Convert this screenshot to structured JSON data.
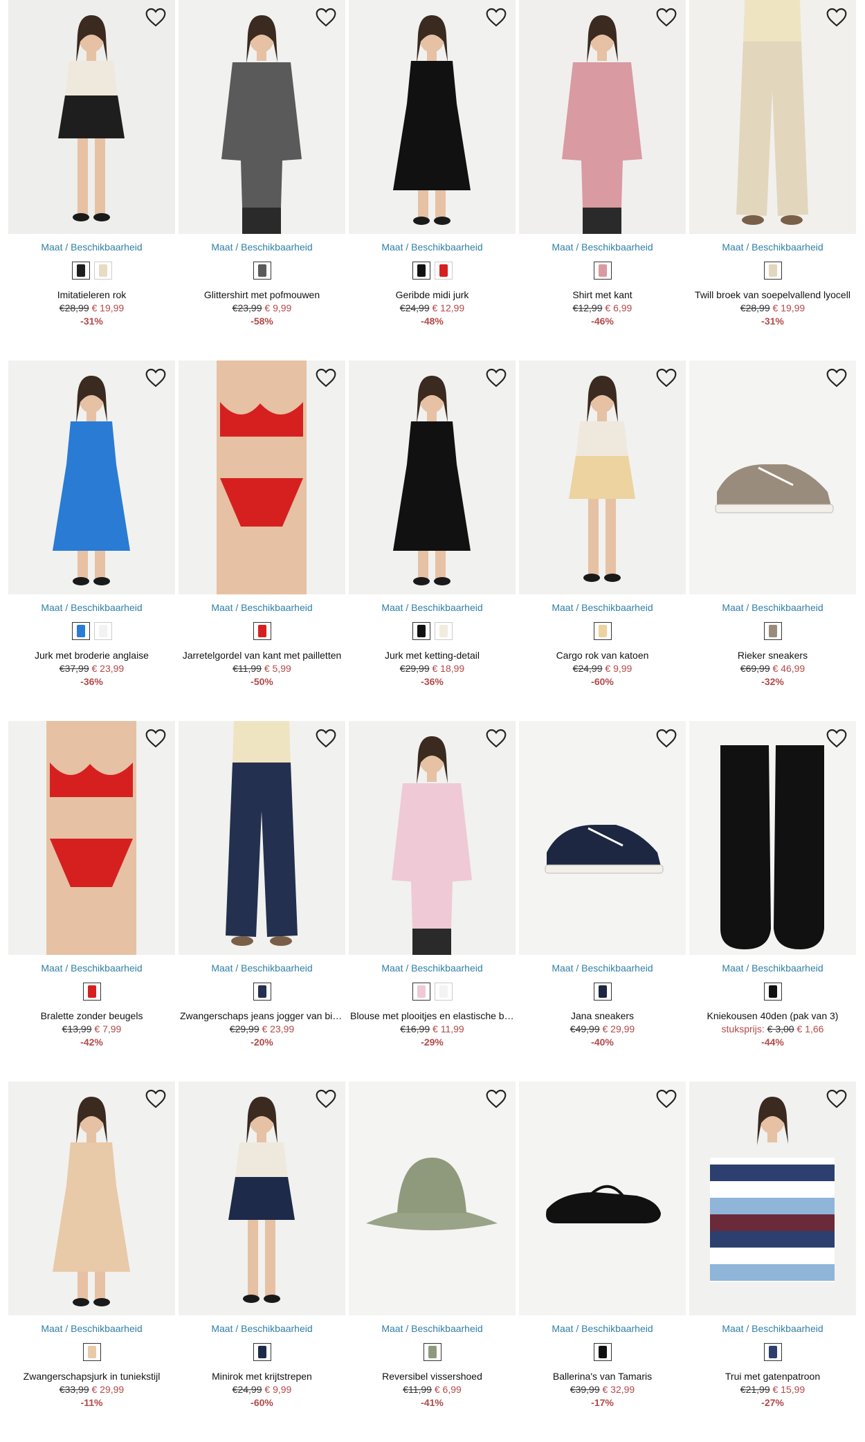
{
  "ui": {
    "availability_label": "Maat / Beschikbaarheid"
  },
  "products": [
    {
      "name": "Imitatieleren rok",
      "old_price": "€28,99",
      "new_price": "€ 19,99",
      "discount": "-31%",
      "icon": "skirt",
      "bg": "#eeeeec",
      "swatches": [
        "#1e1e1e",
        "#e6dcc4"
      ]
    },
    {
      "name": "Glittershirt met pofmouwen",
      "old_price": "€23,99",
      "new_price": "€ 9,99",
      "discount": "-58%",
      "icon": "top",
      "bg": "#f1f1ef",
      "swatches": [
        "#5a5a5a"
      ]
    },
    {
      "name": "Geribde midi jurk",
      "old_price": "€24,99",
      "new_price": "€ 12,99",
      "discount": "-48%",
      "icon": "dress",
      "bg": "#f1f1ef",
      "swatches": [
        "#111111",
        "#d62020"
      ]
    },
    {
      "name": "Shirt met kant",
      "old_price": "€12,99",
      "new_price": "€ 6,99",
      "discount": "-46%",
      "icon": "top",
      "bg": "#f0efed",
      "swatches": [
        "#d99aa2"
      ]
    },
    {
      "name": "Twill broek van soepelvallend lyocell",
      "old_price": "€28,99",
      "new_price": "€ 19,99",
      "discount": "-31%",
      "icon": "pants",
      "bg": "#f1f0ed",
      "swatches": [
        "#e2d6bd"
      ]
    },
    {
      "name": "Jurk met broderie anglaise",
      "old_price": "€37,99",
      "new_price": "€ 23,99",
      "discount": "-36%",
      "icon": "dress",
      "bg": "#f1f1ef",
      "swatches": [
        "#2a7bd4",
        "#f2f2f2"
      ]
    },
    {
      "name": "Jarretelgordel van kant met pailletten",
      "old_price": "€11,99",
      "new_price": "€ 5,99",
      "discount": "-50%",
      "icon": "lingerie",
      "bg": "#f1f1ef",
      "swatches": [
        "#d62020"
      ]
    },
    {
      "name": "Jurk met ketting-detail",
      "old_price": "€29,99",
      "new_price": "€ 18,99",
      "discount": "-36%",
      "icon": "dress",
      "bg": "#f1f1ef",
      "swatches": [
        "#111111",
        "#f1ecdf"
      ]
    },
    {
      "name": "Cargo rok van katoen",
      "old_price": "€24,99",
      "new_price": "€ 9,99",
      "discount": "-60%",
      "icon": "skirt",
      "bg": "#f1f1ef",
      "swatches": [
        "#ecd3a0"
      ]
    },
    {
      "name": "Rieker sneakers",
      "old_price": "€69,99",
      "new_price": "€ 46,99",
      "discount": "-32%",
      "icon": "shoe",
      "bg": "#f4f4f2",
      "swatches": [
        "#9a8c7c"
      ]
    },
    {
      "name": "Bralette zonder beugels",
      "old_price": "€13,99",
      "new_price": "€ 7,99",
      "discount": "-42%",
      "icon": "lingerie",
      "bg": "#f1f1ef",
      "swatches": [
        "#d62020"
      ]
    },
    {
      "name": "Zwangerschaps jeans jogger van biologisch katoen",
      "old_price": "€29,99",
      "new_price": "€ 23,99",
      "discount": "-20%",
      "icon": "pants",
      "bg": "#f1f1ef",
      "swatches": [
        "#23304f"
      ]
    },
    {
      "name": "Blouse met plooitjes en elastische band",
      "old_price": "€16,99",
      "new_price": "€ 11,99",
      "discount": "-29%",
      "icon": "top",
      "bg": "#f1f1ef",
      "swatches": [
        "#efc9d6",
        "#f3f3f3"
      ]
    },
    {
      "name": "Jana sneakers",
      "old_price": "€49,99",
      "new_price": "€ 29,99",
      "discount": "-40%",
      "icon": "shoe",
      "bg": "#f4f4f2",
      "swatches": [
        "#1d2742"
      ]
    },
    {
      "name": "Kniekousen 40den (pak van 3)",
      "unit_label": "stuksprijs:",
      "old_price": "€ 3,00",
      "new_price": "€ 1,66",
      "discount": "-44%",
      "icon": "socks",
      "bg": "#f4f4f2",
      "swatches": [
        "#111111"
      ]
    },
    {
      "name": "Zwangerschapsjurk in tuniekstijl",
      "old_price": "€33,99",
      "new_price": "€ 29,99",
      "discount": "-11%",
      "icon": "dress",
      "bg": "#f1f1ef",
      "swatches": [
        "#e8c9a8"
      ]
    },
    {
      "name": "Minirok met krijtstrepen",
      "old_price": "€24,99",
      "new_price": "€ 9,99",
      "discount": "-60%",
      "icon": "skirt",
      "bg": "#f1f1ef",
      "swatches": [
        "#1e2a4a"
      ]
    },
    {
      "name": "Reversibel vissershoed",
      "old_price": "€11,99",
      "new_price": "€ 6,99",
      "discount": "-41%",
      "icon": "hat",
      "bg": "#f4f4f2",
      "swatches": [
        "#8f9a7c"
      ]
    },
    {
      "name": "Ballerina's van Tamaris",
      "old_price": "€39,99",
      "new_price": "€ 32,99",
      "discount": "-17%",
      "icon": "flat",
      "bg": "#f4f4f2",
      "swatches": [
        "#111111"
      ]
    },
    {
      "name": "Trui met gatenpatroon",
      "old_price": "€21,99",
      "new_price": "€ 15,99",
      "discount": "-27%",
      "icon": "sweater",
      "bg": "#f1f1ef",
      "swatches": [
        "#2c3f6e"
      ]
    }
  ]
}
